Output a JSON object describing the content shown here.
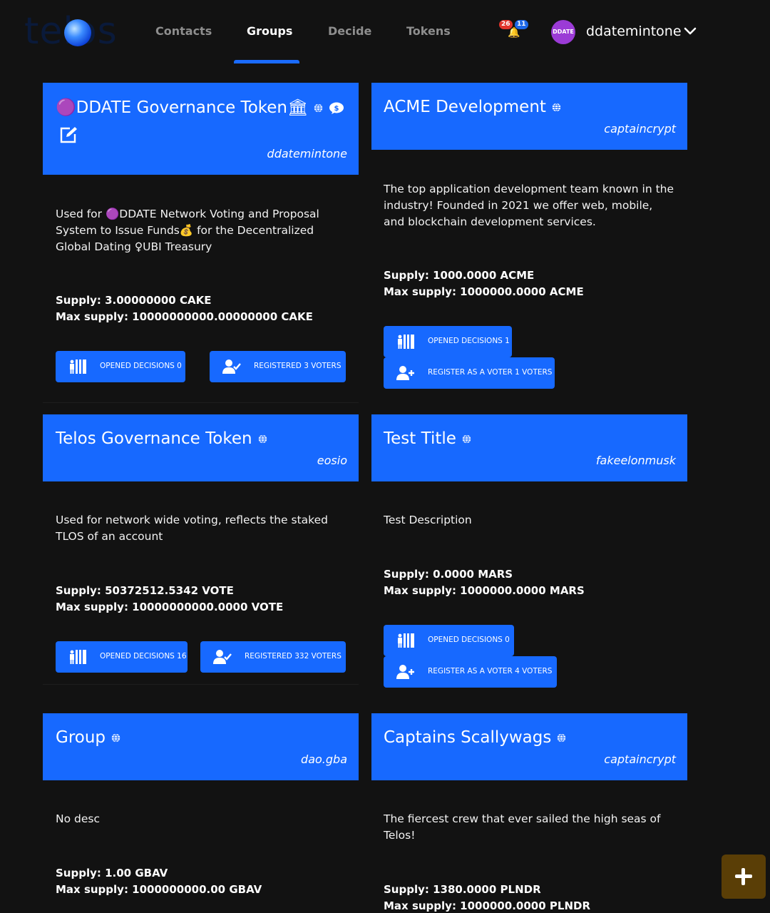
{
  "header": {
    "logo": "telos",
    "nav": [
      {
        "label": "Contacts"
      },
      {
        "label": "Groups"
      },
      {
        "label": "Decide"
      },
      {
        "label": "Tokens"
      }
    ],
    "active_tab": "Groups",
    "notifications": {
      "red": "26",
      "blue": "11"
    },
    "avatar_text": "DDATE",
    "username": "ddatemintone"
  },
  "cards": [
    {
      "title": "🟣DDATE Governance Token🏛",
      "owner": "ddatemintone",
      "desc": "Used for 🟣DDATE Network Voting and Proposal System to Issue Funds💰 for the Decentralized Global Dating ♀UBI Treasury",
      "supply": "Supply: 3.00000000 CAKE",
      "max_supply": "Max supply: 10000000000.00000000 CAKE",
      "btn1": "OPENED DECISIONS 0",
      "btn2": "REGISTERED 3 VOTERS"
    },
    {
      "title": "ACME Development",
      "owner": "captaincrypt",
      "desc": "The top application development team known in the industry! Founded in 2021 we offer web, mobile, and blockchain development services.",
      "supply": "Supply: 1000.0000 ACME",
      "max_supply": "Max supply: 1000000.0000 ACME",
      "btn1": "OPENED DECISIONS 1",
      "btn2": "REGISTER AS A VOTER 1 VOTERS"
    },
    {
      "title": "Telos Governance Token",
      "owner": "eosio",
      "desc": "Used for network wide voting, reflects the staked TLOS of an account",
      "supply": "Supply: 50372512.5342 VOTE",
      "max_supply": "Max supply: 10000000000.0000 VOTE",
      "btn1": "OPENED DECISIONS 16",
      "btn2": "REGISTERED 332 VOTERS"
    },
    {
      "title": "Test Title",
      "owner": "fakeelonmusk",
      "desc": "Test Description",
      "supply": "Supply: 0.0000 MARS",
      "max_supply": "Max supply: 1000000.0000 MARS",
      "btn1": "OPENED DECISIONS 0",
      "btn2": "REGISTER AS A VOTER 4 VOTERS"
    },
    {
      "title": "Group",
      "owner": "dao.gba",
      "desc": "No desc",
      "supply": "Supply: 1.00 GBAV",
      "max_supply": "Max supply: 1000000000.00 GBAV"
    },
    {
      "title": "Captains Scallywags",
      "owner": "captaincrypt",
      "desc": "The fiercest crew that ever sailed the high seas of Telos!",
      "supply": "Supply: 1380.0000 PLNDR",
      "max_supply": "Max supply: 1000000.0000 PLNDR"
    }
  ],
  "fab_label": "+",
  "colors": {
    "accent": "#1769ff",
    "background": "#121212",
    "fab": "#5a3e06"
  }
}
